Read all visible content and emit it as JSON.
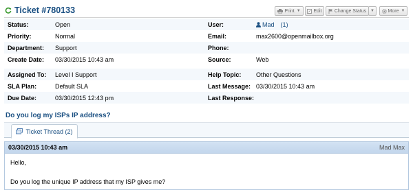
{
  "ticket": {
    "title": "Ticket #780133",
    "subject": "Do you log my ISPs IP address?"
  },
  "toolbar": {
    "print": "Print",
    "edit": "Edit",
    "change_status": "Change Status",
    "more": "More"
  },
  "info": [
    {
      "l1": "Status:",
      "v1": "Open",
      "l2": "User:",
      "v2": "Mad",
      "v2b": "(1)"
    },
    {
      "l1": "Priority:",
      "v1": "Normal",
      "l2": "Email:",
      "v2": "max2600@openmailbox.org"
    },
    {
      "l1": "Department:",
      "v1": "Support",
      "l2": "Phone:",
      "v2": ""
    },
    {
      "l1": "Create Date:",
      "v1": "03/30/2015 10:43 am",
      "l2": "Source:",
      "v2": "Web"
    }
  ],
  "assign": [
    {
      "l1": "Assigned To:",
      "v1": "Level I Support",
      "l2": "Help Topic:",
      "v2": "Other Questions"
    },
    {
      "l1": "SLA Plan:",
      "v1": "Default SLA",
      "l2": "Last Message:",
      "v2": "03/30/2015 10:43 am"
    },
    {
      "l1": "Due Date:",
      "v1": "03/30/2015 12:43 pm",
      "l2": "Last Response:",
      "v2": ""
    }
  ],
  "tabs": {
    "thread": "Ticket Thread (2)"
  },
  "thread": {
    "date": "03/30/2015 10:43 am",
    "author": "Mad Max",
    "lines": [
      "Hello,",
      "Do you log the unique IP address that my ISP gives me?"
    ]
  }
}
